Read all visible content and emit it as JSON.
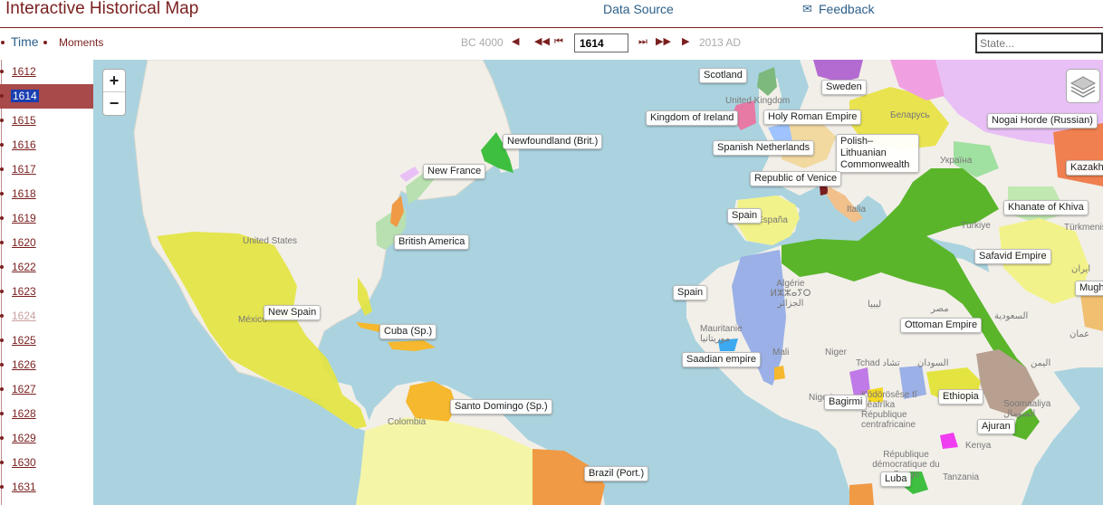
{
  "header": {
    "title": "Interactive Historical Map",
    "data_source": "Data Source",
    "feedback": "Feedback"
  },
  "nav": {
    "time_tab": "Time",
    "moments_tab": "Moments",
    "range_start": "BC 4000",
    "range_end": "2013 AD",
    "current_year": "1614",
    "search_placeholder": "State..."
  },
  "timeline": {
    "years": [
      "1612",
      "1614",
      "1615",
      "1616",
      "1617",
      "1618",
      "1619",
      "1620",
      "1622",
      "1623",
      "1624",
      "1625",
      "1626",
      "1627",
      "1628",
      "1629",
      "1630",
      "1631"
    ],
    "active": "1614",
    "dimmed": "1624"
  },
  "map": {
    "state_labels": {
      "scotland": "Scotland",
      "sweden": "Sweden",
      "kingdom_of_ireland": "Kingdom of Ireland",
      "holy_roman_empire": "Holy Roman Empire",
      "nogai_horde": "Nogai Horde (Russian)",
      "newfoundland": "Newfoundland (Brit.)",
      "spanish_netherlands": "Spanish Netherlands",
      "polish_lithuanian": "Polish–Lithuanian Commonwealth",
      "kazakh": "Kazakh",
      "new_france": "New France",
      "republic_of_venice": "Republic of Venice",
      "khanate_of_khiva": "Khanate of Khiva",
      "spain_1": "Spain",
      "british_america": "British America",
      "safavid_empire": "Safavid Empire",
      "spain_2": "Spain",
      "mughal": "Mughal E",
      "new_spain": "New Spain",
      "ottoman_empire": "Ottoman Empire",
      "cuba": "Cuba (Sp.)",
      "saadian_empire": "Saadian empire",
      "ethiopia": "Ethiopia",
      "bagirmi": "Bagirmi",
      "santo_domingo": "Santo Domingo (Sp.)",
      "ajuran": "Ajuran",
      "brazil": "Brazil (Port.)",
      "luba": "Luba"
    },
    "base_labels": {
      "united_kingdom": "United Kingdom",
      "united_states": "United States",
      "mexico": "México",
      "belarus": "Беларусь",
      "ukraine": "Україна",
      "espana": "España",
      "italia": "Italia",
      "turkiye": "Türkiye",
      "turkmenistan": "Türkmenistan",
      "iran": "ایران",
      "algerie": "Algérie ⵍⵣⵣⴰⵢⵔ الجزائر",
      "libya": "ليبيا",
      "egypt": "مصر",
      "saudi": "السعودية",
      "oman": "عمان",
      "yemen": "اليمن",
      "mauritanie": "Mauritanie موريتانيا",
      "mali": "Mali",
      "niger": "Niger",
      "tchad": "Tchad تشاد",
      "sudan": "السودان",
      "nigeria": "Nigeria",
      "car": "Ködörösêse tî Bêafrîka République centrafricaine",
      "somalia": "Soomaaliya الصومال",
      "kenya": "Kenya",
      "colombia": "Colombia",
      "rdc": "République démocratique du Congo",
      "tanzania": "Tanzania"
    },
    "colors": {
      "ocean": "#aad3df",
      "land": "#f2efe9",
      "spain_yellow": "#f2f28a",
      "new_spain": "#e4e441",
      "ottoman": "#5ab52a",
      "saadian": "#9bb0e6",
      "brazil": "#f09a45",
      "newfoundland": "#3fbf3f",
      "nogai": "#e8c0f5",
      "timeline_active": "#a84a4a",
      "brand": "#7a1f1f"
    }
  }
}
